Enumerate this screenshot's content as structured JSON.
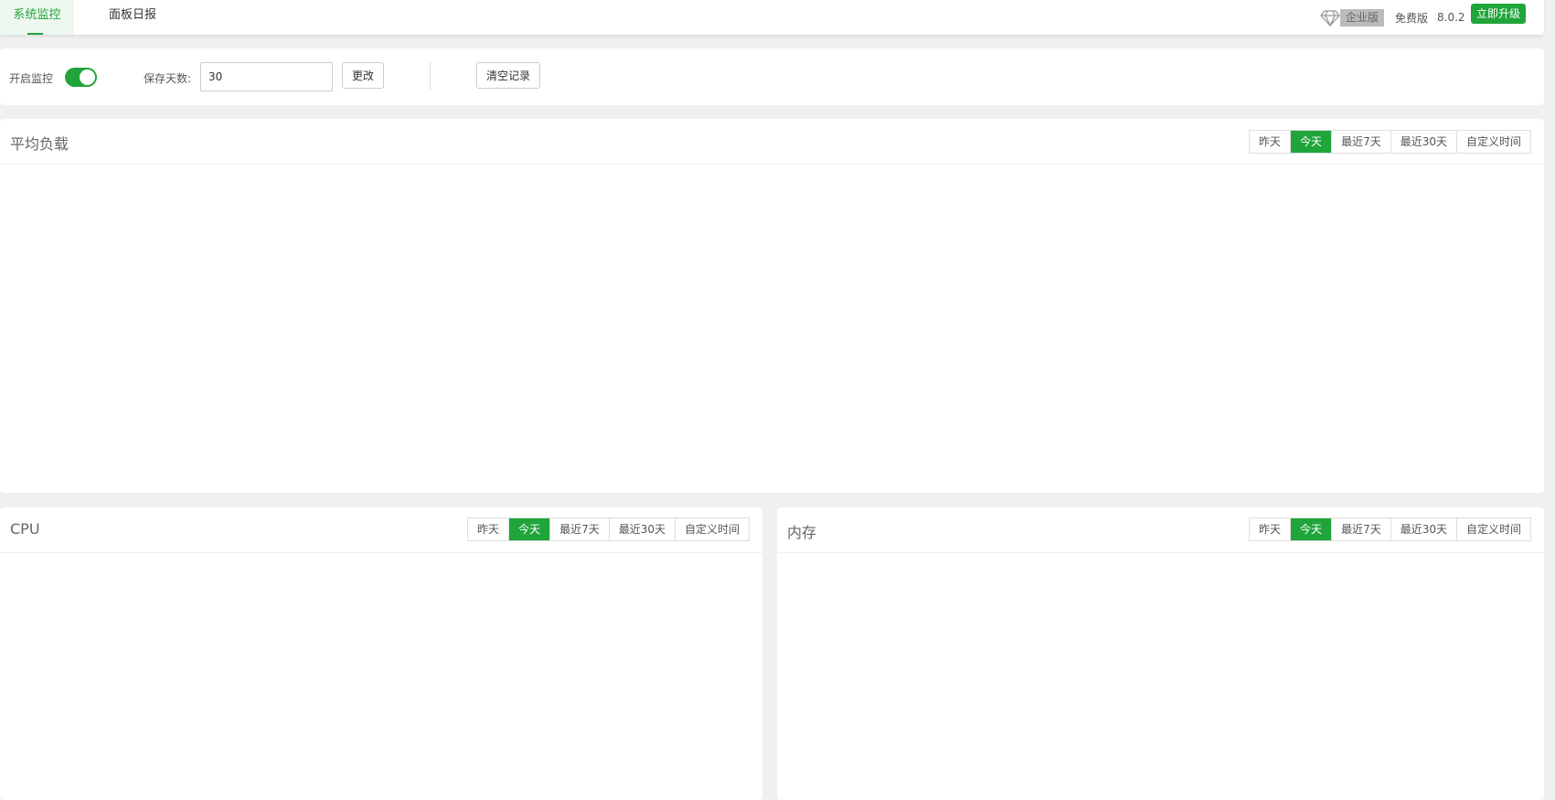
{
  "tabs": [
    {
      "label": "系统监控",
      "active": true
    },
    {
      "label": "面板日报",
      "active": false
    }
  ],
  "header_right": {
    "enterprise": "企业版",
    "free": "免费版",
    "version": "8.0.2",
    "upgrade": "立即升级"
  },
  "settings": {
    "monitor_label": "开启监控",
    "monitor_on": true,
    "days_label": "保存天数:",
    "days_value": "30",
    "change": "更改",
    "clear": "清空记录"
  },
  "ranges": [
    "昨天",
    "今天",
    "最近7天",
    "最近30天",
    "自定义时间"
  ],
  "active_range": "今天",
  "panels": {
    "load": "平均负载",
    "cpu": "CPU",
    "memory": "内存"
  },
  "colors": {
    "accent": "#20a53a"
  }
}
